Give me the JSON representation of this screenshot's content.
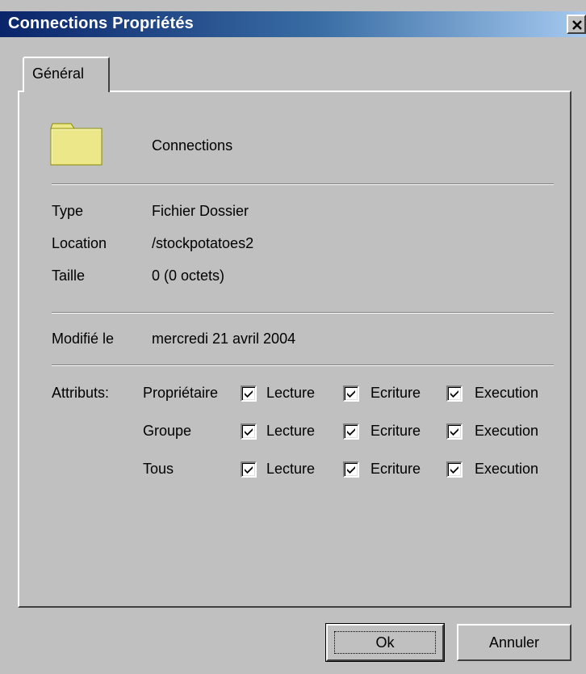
{
  "window": {
    "title": "Connections Propriétés"
  },
  "tabs": [
    {
      "label": "Général",
      "active": true
    }
  ],
  "file": {
    "name": "Connections",
    "icon": "folder-icon"
  },
  "properties": {
    "type_label": "Type",
    "type_value": "Fichier Dossier",
    "location_label": "Location",
    "location_value": "/stockpotatoes2",
    "size_label": "Taille",
    "size_value": "0 (0 octets)",
    "modified_label": "Modifié le",
    "modified_value": "mercredi 21 avril 2004"
  },
  "attributes": {
    "label": "Attributs:",
    "permission_labels": [
      "Lecture",
      "Ecriture",
      "Execution"
    ],
    "rows": [
      {
        "name": "Propriétaire",
        "read": true,
        "write": true,
        "execute": true
      },
      {
        "name": "Groupe",
        "read": true,
        "write": true,
        "execute": true
      },
      {
        "name": "Tous",
        "read": true,
        "write": true,
        "execute": true
      }
    ]
  },
  "buttons": {
    "ok": "Ok",
    "cancel": "Annuler"
  },
  "colors": {
    "titlebar_start": "#0a246a",
    "titlebar_end": "#a6caf0",
    "face": "#c0c0c0",
    "folder": "#ece88a"
  }
}
